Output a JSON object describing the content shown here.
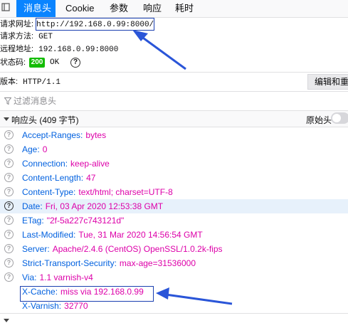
{
  "tabs": [
    {
      "label": "消息头",
      "active": true
    },
    {
      "label": "Cookie"
    },
    {
      "label": "参数"
    },
    {
      "label": "响应"
    },
    {
      "label": "耗时"
    }
  ],
  "summary": {
    "url_label": "请求网址:",
    "url_value": "http://192.168.0.99:8000/",
    "method_label": "请求方法:",
    "method_value": "GET",
    "remote_label": "远程地址:",
    "remote_value": "192.168.0.99:8000",
    "status_label": "状态码:",
    "status_code": "200",
    "status_text": "OK",
    "version_label": "版本:",
    "version_value": "HTTP/1.1",
    "edit_button": "编辑和重发"
  },
  "filter": {
    "placeholder": "过滤消息头"
  },
  "response_headers": {
    "title": "响应头 (409 字节)",
    "raw_label": "原始头",
    "items": [
      {
        "name": "Accept-Ranges:",
        "value": "bytes"
      },
      {
        "name": "Age:",
        "value": "0"
      },
      {
        "name": "Connection:",
        "value": "keep-alive"
      },
      {
        "name": "Content-Length:",
        "value": "47"
      },
      {
        "name": "Content-Type:",
        "value": "text/html; charset=UTF-8"
      },
      {
        "name": "Date:",
        "value": "Fri, 03 Apr 2020 12:53:38 GMT"
      },
      {
        "name": "ETag:",
        "value": "\"2f-5a227c743121d\""
      },
      {
        "name": "Last-Modified:",
        "value": "Tue, 31 Mar 2020 14:56:54 GMT"
      },
      {
        "name": "Server:",
        "value": "Apache/2.4.6 (CentOS) OpenSSL/1.0.2k-fips"
      },
      {
        "name": "Strict-Transport-Security:",
        "value": "max-age=31536000"
      },
      {
        "name": "Via:",
        "value": "1.1 varnish-v4"
      },
      {
        "name": "X-Cache:",
        "value": "miss via 192.168.0.99"
      },
      {
        "name": "X-Varnish:",
        "value": "32770"
      }
    ]
  },
  "colors": {
    "accent": "#0a84ff",
    "header_name": "#0060df",
    "header_value": "#dd00a9",
    "status_ok": "#12bc00",
    "annotation": "#1a3fb0"
  }
}
